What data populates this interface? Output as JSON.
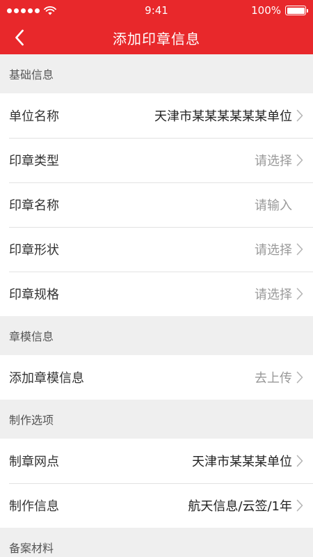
{
  "status_bar": {
    "time": "9:41",
    "battery": "100%",
    "battery_level": 1.0
  },
  "nav": {
    "title": "添加印章信息"
  },
  "sections": [
    {
      "title": "基础信息",
      "rows": [
        {
          "label": "单位名称",
          "value": "天津市某某某某某某单位",
          "placeholder": false,
          "chevron": true
        },
        {
          "label": "印章类型",
          "value": "请选择",
          "placeholder": true,
          "chevron": true
        },
        {
          "label": "印章名称",
          "value": "请输入",
          "placeholder": true,
          "chevron": false
        },
        {
          "label": "印章形状",
          "value": "请选择",
          "placeholder": true,
          "chevron": true
        },
        {
          "label": "印章规格",
          "value": "请选择",
          "placeholder": true,
          "chevron": true
        }
      ]
    },
    {
      "title": "章模信息",
      "rows": [
        {
          "label": "添加章模信息",
          "value": "去上传",
          "placeholder": true,
          "chevron": true
        }
      ]
    },
    {
      "title": "制作选项",
      "rows": [
        {
          "label": "制章网点",
          "value": "天津市某某某单位",
          "placeholder": false,
          "chevron": true
        },
        {
          "label": "制作信息",
          "value": "航天信息/云签/1年",
          "placeholder": false,
          "chevron": true
        }
      ]
    },
    {
      "title": "备案材料",
      "rows": []
    }
  ],
  "colors": {
    "brand": "#e8282b",
    "background": "#efefef",
    "divider": "#e2e2e2"
  }
}
